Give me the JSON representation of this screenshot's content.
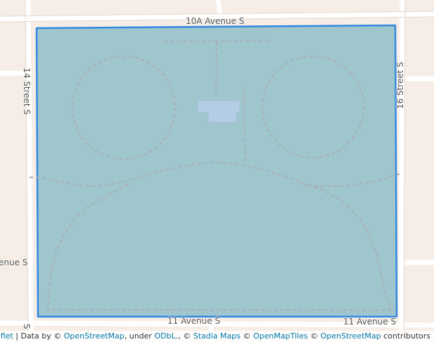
{
  "map": {
    "colors": {
      "background": "#f6eee6",
      "park_fill": "#9fc6cd",
      "park_border": "#3388e0",
      "path": "#a9b0b7",
      "building": "#b4cde4",
      "road": "#ffffff"
    },
    "street_labels": {
      "top": "10A Avenue S",
      "left_vertical": "14 Street S",
      "right_vertical": "16 Street S",
      "bottom_left": "11 Avenue S",
      "bottom_right": "11 Avenue S",
      "left_partial": "enue S",
      "corner_partial": "S"
    }
  },
  "attribution": {
    "leaflet": "Leaflet",
    "sep": " | ",
    "data_by": "Data by © ",
    "osm": "OpenStreetMap",
    "under": ", under ",
    "odbl": "ODbL",
    "comma_c": "., © ",
    "stadia": "Stadia Maps",
    "c1": " © ",
    "omt": "OpenMapTiles",
    "c2": " © ",
    "osm2": "OpenStreetMap",
    "contributors": " contributors"
  }
}
